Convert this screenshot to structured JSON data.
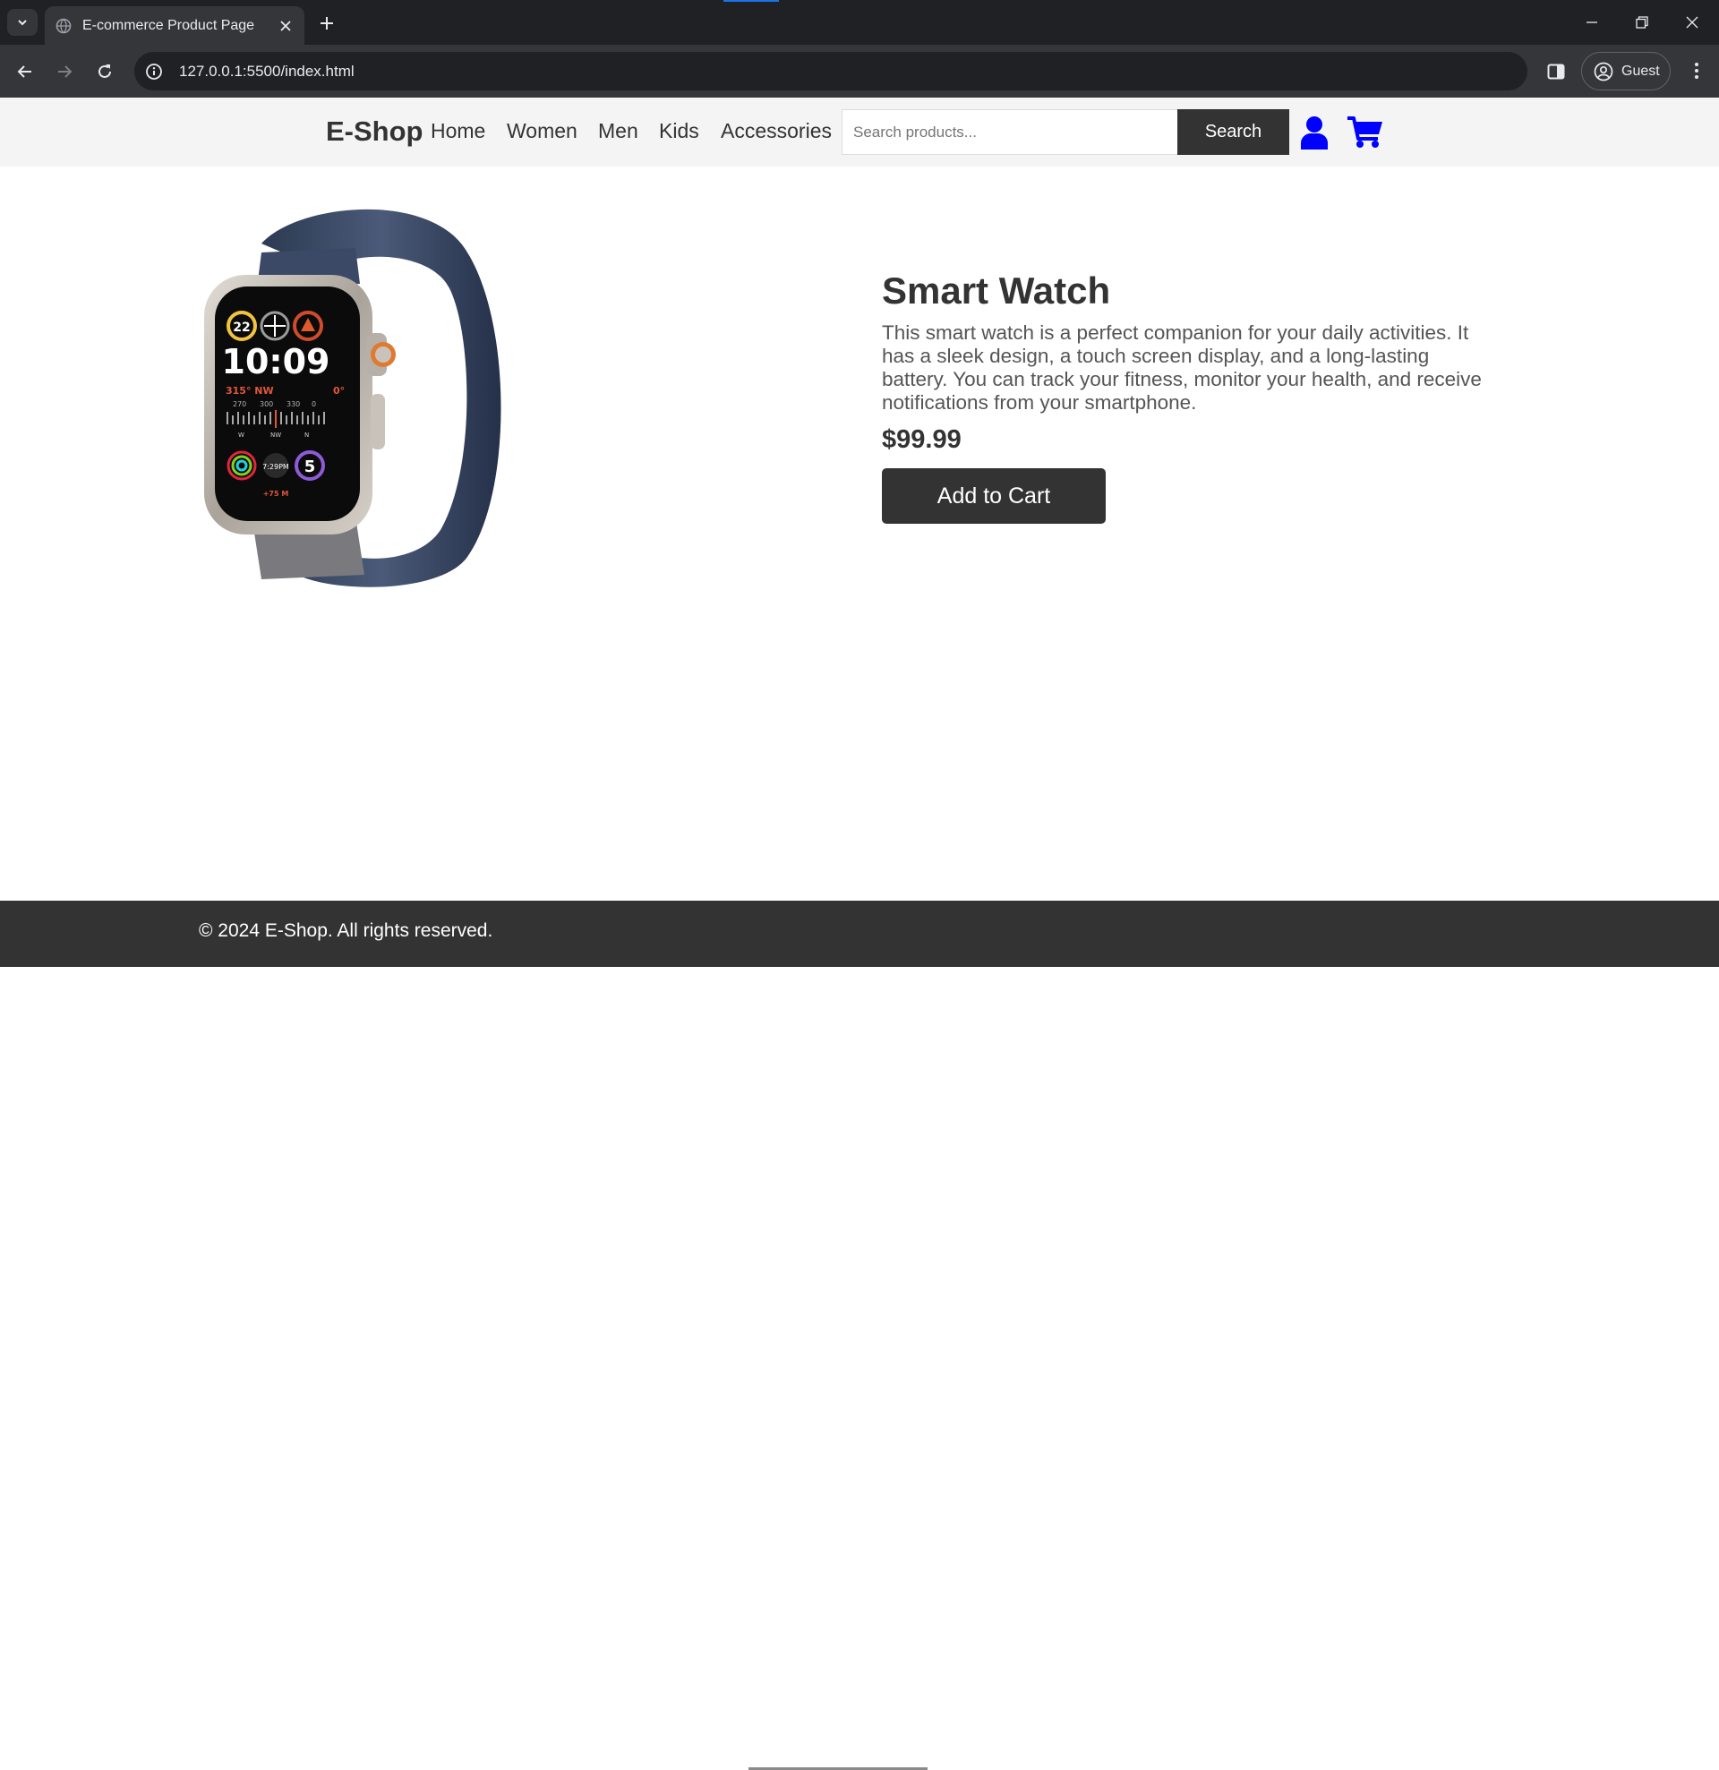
{
  "browser": {
    "tab_title": "E-commerce Product Page",
    "url": "127.0.0.1:5500/index.html",
    "profile_label": "Guest"
  },
  "site": {
    "logo": "E-Shop",
    "nav": [
      "Home",
      "Women",
      "Men",
      "Kids",
      "Accessories"
    ],
    "search_placeholder": "Search products...",
    "search_button": "Search",
    "icon_color": "#0000ff"
  },
  "product": {
    "title": "Smart Watch",
    "description": "This smart watch is a perfect companion for your daily activities. It has a sleek design, a touch screen display, and a long-lasting battery. You can track your fitness, monitor your health, and receive notifications from your smartphone.",
    "price": "$99.99",
    "add_to_cart": "Add to Cart",
    "image": {
      "watch_face_time": "10:09",
      "complication_top_left": "22",
      "heading": "315° NW",
      "temp": "0°",
      "compass_labels": [
        "270",
        "300",
        "330",
        "0"
      ],
      "compass_letters": [
        "W",
        "NW",
        "N"
      ],
      "bottom_time": "7:29PM",
      "bottom_right": "5",
      "elevation": "+75 M"
    }
  },
  "footer": {
    "copyright": "© 2024 E-Shop. All rights reserved."
  }
}
